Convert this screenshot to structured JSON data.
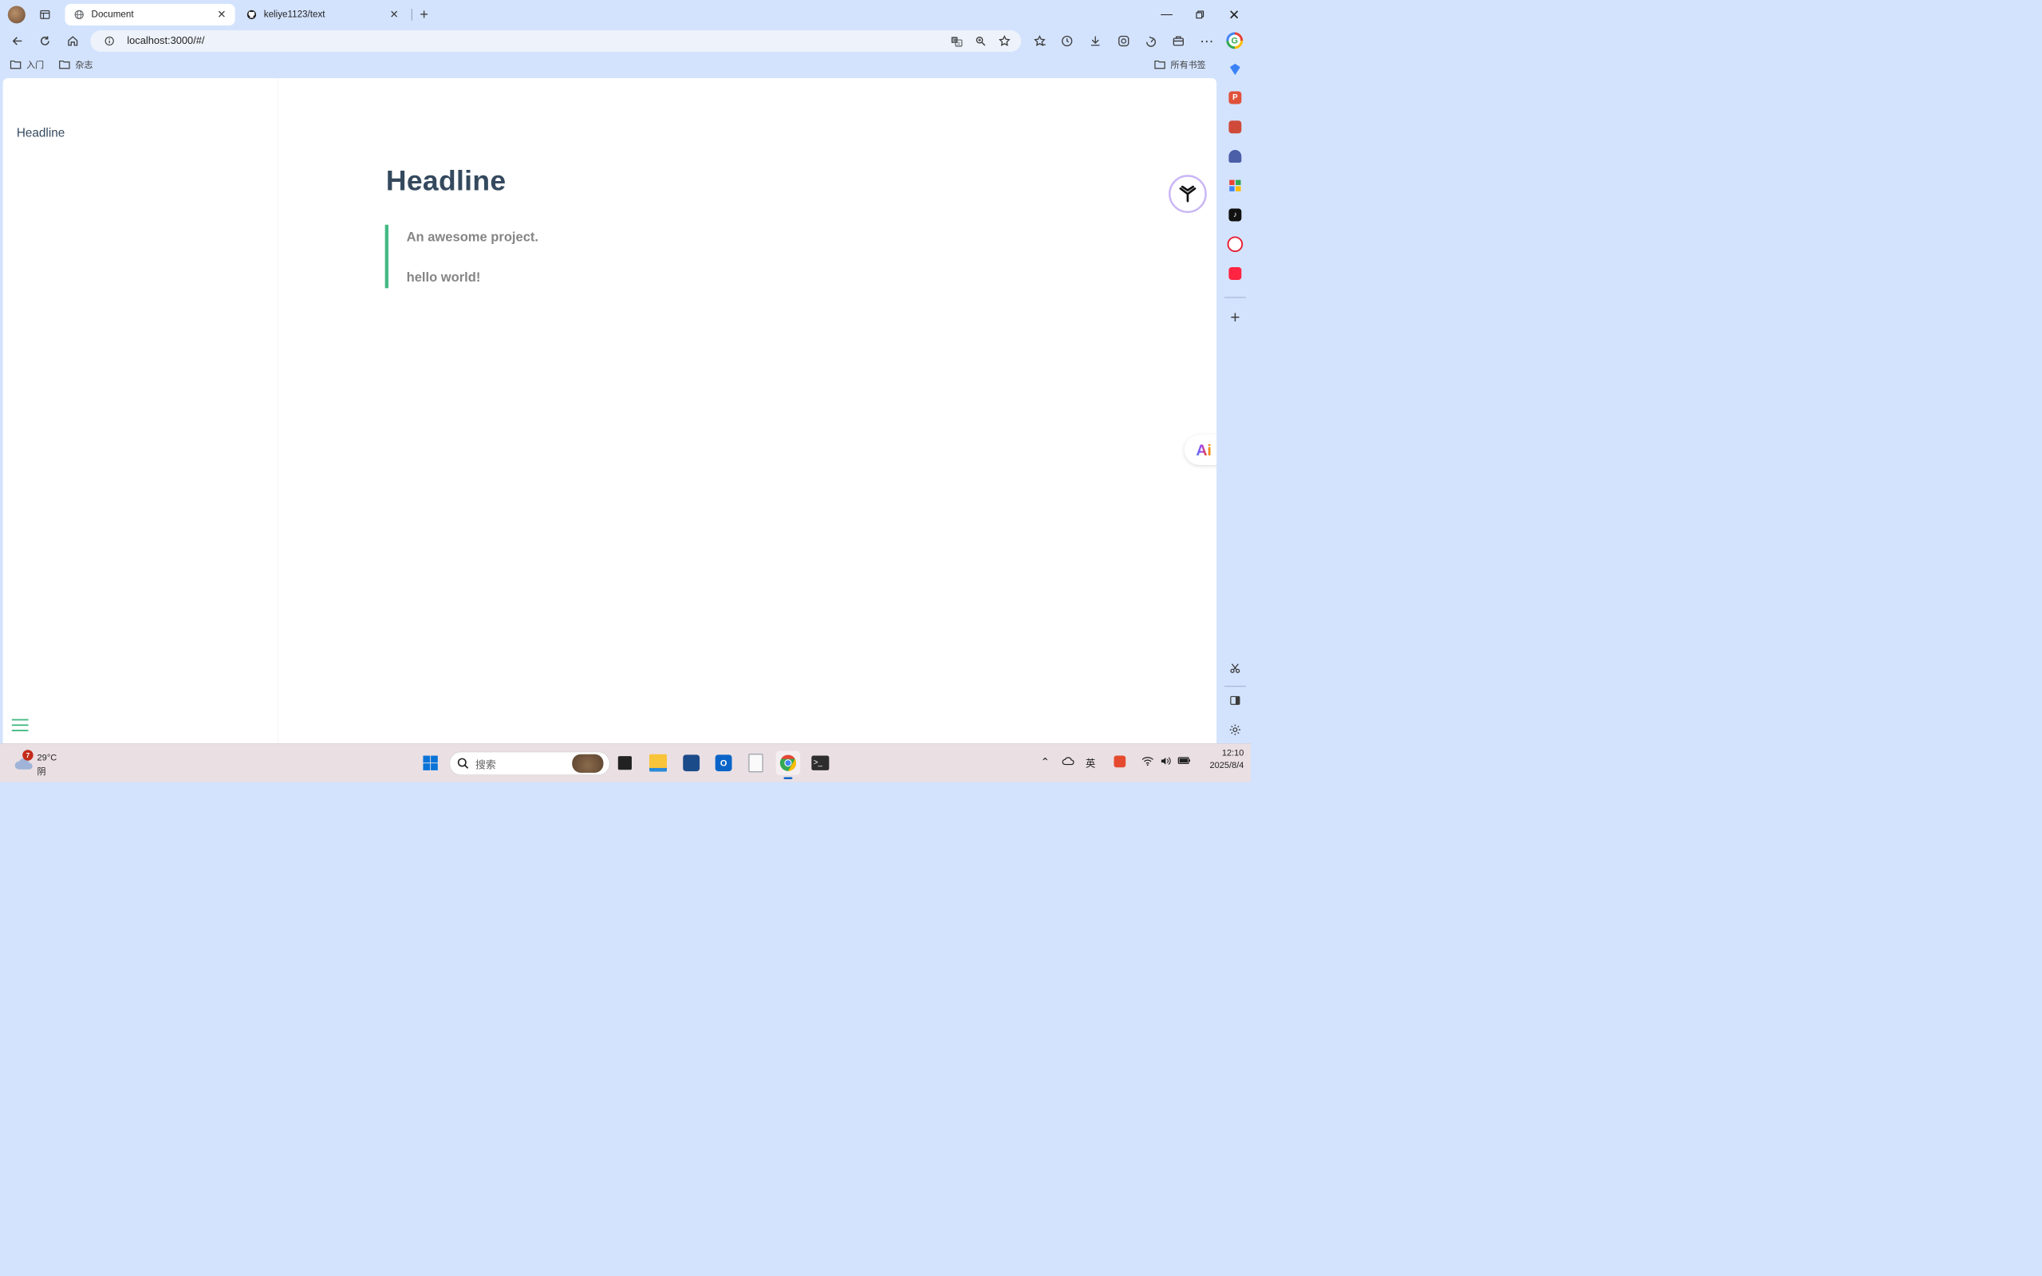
{
  "browser": {
    "tabs": [
      {
        "title": "Document",
        "active": true
      },
      {
        "title": "keliye1123/text",
        "active": false
      }
    ],
    "url": "localhost:3000/#/",
    "bookmarks": [
      {
        "label": "入门"
      },
      {
        "label": "杂志"
      }
    ],
    "all_bookmarks_label": "所有书签"
  },
  "page": {
    "sidebar": {
      "items": [
        {
          "label": "Headline"
        }
      ]
    },
    "content": {
      "title": "Headline",
      "quote_lines": [
        "An awesome project.",
        "hello world!"
      ]
    },
    "ai_button_label": "Ai"
  },
  "taskbar": {
    "weather": {
      "temp": "29°C",
      "condition": "阴",
      "badge": "7"
    },
    "search_placeholder": "搜索",
    "time": "12:10",
    "date": "2025/8/4"
  },
  "colors": {
    "accent": "#42b983",
    "heading": "#34495e",
    "quote_text": "#858585",
    "browser_frame": "#d3e3fd"
  }
}
